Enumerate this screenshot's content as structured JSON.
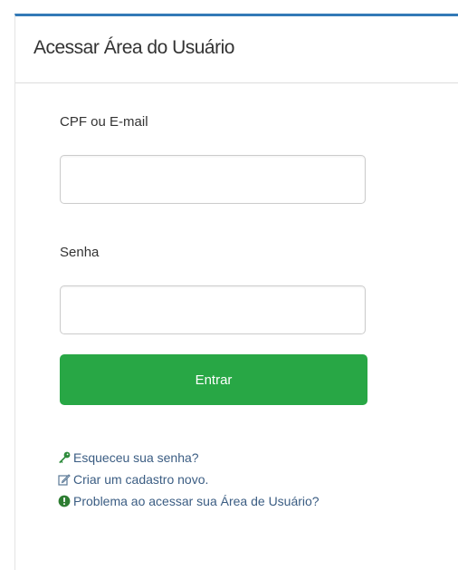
{
  "colors": {
    "accent_bar": "#337ab7",
    "button": "#28a745",
    "link": "#3b5d83",
    "key_icon": "#2e8b3c",
    "alert_icon": "#2e7d32"
  },
  "login": {
    "title": "Acessar Área do Usuário",
    "user_label": "CPF ou E-mail",
    "user_value": "",
    "password_label": "Senha",
    "password_value": "",
    "submit_label": "Entrar",
    "links": [
      {
        "icon": "key-icon",
        "label": "Esqueceu sua senha?"
      },
      {
        "icon": "edit-icon",
        "label": "Criar um cadastro novo."
      },
      {
        "icon": "exclamation-circle-icon",
        "label": "Problema ao acessar sua Área de Usuário?"
      }
    ]
  }
}
